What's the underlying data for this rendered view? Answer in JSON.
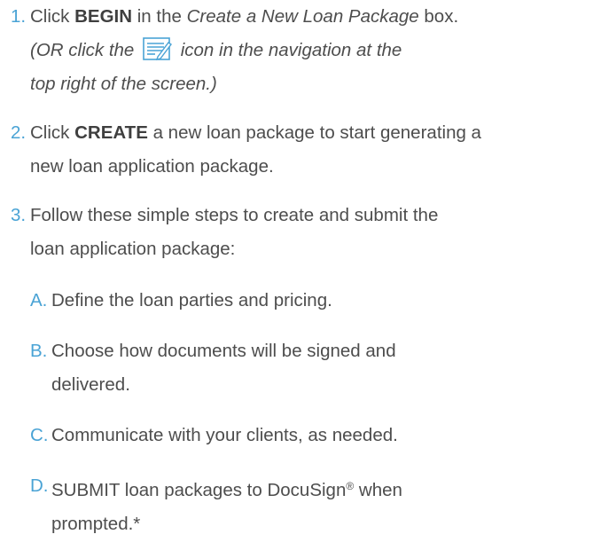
{
  "steps": [
    {
      "num": "1.",
      "pre": "Click ",
      "bold": "BEGIN",
      "mid": " in the ",
      "italic": "Create a New Loan Package",
      "post": " box.",
      "note_pre": "(OR click the ",
      "note_post": " icon in the navigation at the",
      "note_line3": "top right of the screen.)",
      "icon": "document-edit-icon"
    },
    {
      "num": "2.",
      "pre": "Click ",
      "bold": "CREATE",
      "post_line1": " a new loan package to start generating a",
      "line2": "new loan application package."
    },
    {
      "num": "3.",
      "line1": "Follow these simple steps to create and submit the",
      "line2": "loan application package:"
    }
  ],
  "substeps": [
    {
      "letter": "A.",
      "line1": "Define the loan parties and pricing."
    },
    {
      "letter": "B.",
      "line1": "Choose how documents will be signed and",
      "line2": "delivered."
    },
    {
      "letter": "C.",
      "line1": "Communicate with your clients, as needed."
    },
    {
      "letter": "D.",
      "line1_pre": "SUBMIT loan packages to DocuSign",
      "reg": "®",
      "line1_post": " when",
      "line2": "prompted.*"
    }
  ],
  "colors": {
    "number_accent": "#4aa3d5",
    "text": "#4d4d4d",
    "icon": "#4aa3d5"
  }
}
